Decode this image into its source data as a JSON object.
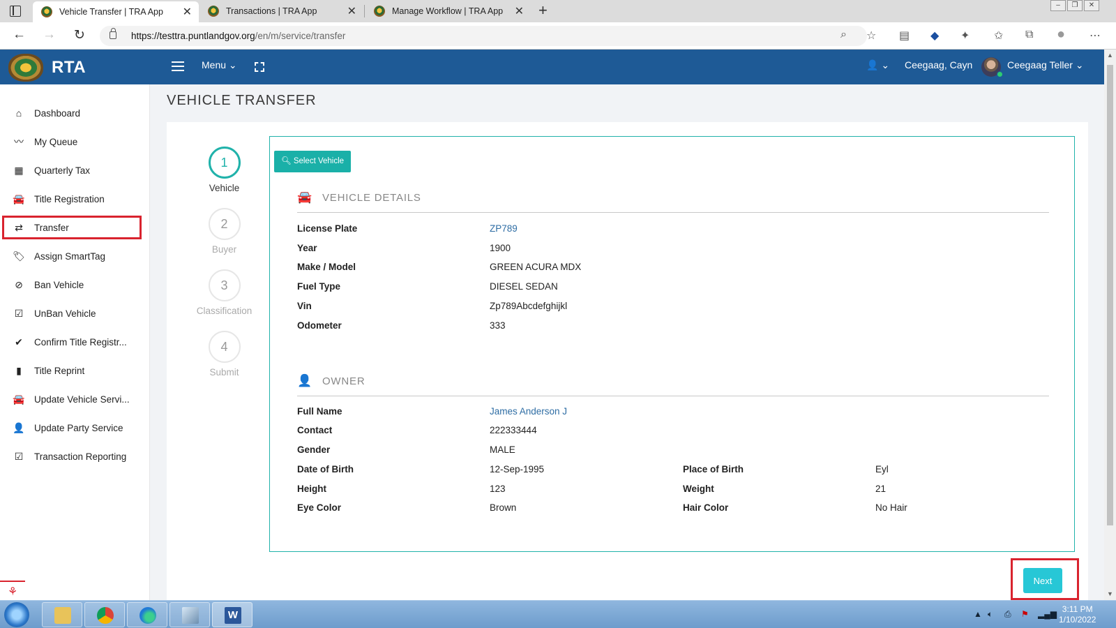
{
  "browser": {
    "tabs": [
      {
        "title": "Vehicle Transfer | TRA App",
        "active": true
      },
      {
        "title": "Transactions | TRA App",
        "active": false
      },
      {
        "title": "Manage Workflow | TRA App",
        "active": false
      }
    ],
    "url_host": "https://testtra.puntlandgov.org",
    "url_path": "/en/m/service/transfer"
  },
  "header": {
    "brand": "RTA",
    "menu_label": "Menu",
    "user_short": "Ceegaag, Cayn",
    "user_role": "Ceegaag Teller"
  },
  "sidebar": {
    "items": [
      {
        "label": "Dashboard",
        "icon": "home-icon"
      },
      {
        "label": "My Queue",
        "icon": "line-chart-icon"
      },
      {
        "label": "Quarterly Tax",
        "icon": "calculator-icon"
      },
      {
        "label": "Title Registration",
        "icon": "car-icon"
      },
      {
        "label": "Transfer",
        "icon": "exchange-icon"
      },
      {
        "label": "Assign SmartTag",
        "icon": "tags-icon"
      },
      {
        "label": "Ban Vehicle",
        "icon": "ban-icon"
      },
      {
        "label": "UnBan Vehicle",
        "icon": "check-square-icon"
      },
      {
        "label": "Confirm Title Registr...",
        "icon": "check-icon"
      },
      {
        "label": "Title Reprint",
        "icon": "file-icon"
      },
      {
        "label": "Update Vehicle Servi...",
        "icon": "car-icon"
      },
      {
        "label": "Update Party Service",
        "icon": "user-icon"
      },
      {
        "label": "Transaction Reporting",
        "icon": "check-square-icon"
      }
    ]
  },
  "page": {
    "title": "VEHICLE TRANSFER",
    "steps": [
      {
        "num": "1",
        "label": "Vehicle"
      },
      {
        "num": "2",
        "label": "Buyer"
      },
      {
        "num": "3",
        "label": "Classification"
      },
      {
        "num": "4",
        "label": "Submit"
      }
    ],
    "select_vehicle_label": "Select Vehicle",
    "vehicle_section": "VEHICLE DETAILS",
    "vehicle": [
      {
        "key": "License Plate",
        "value": "ZP789"
      },
      {
        "key": "Year",
        "value": "1900"
      },
      {
        "key": "Make / Model",
        "value": "GREEN ACURA MDX"
      },
      {
        "key": "Fuel Type",
        "value": "DIESEL SEDAN"
      },
      {
        "key": "Vin",
        "value": "Zp789Abcdefghijkl"
      },
      {
        "key": "Odometer",
        "value": "333"
      }
    ],
    "owner_section": "OWNER",
    "owner": [
      {
        "key": "Full Name",
        "value": "James Anderson J"
      },
      {
        "key": "Contact",
        "value": "222333444"
      },
      {
        "key": "Gender",
        "value": "MALE"
      },
      {
        "key": "Date of Birth",
        "value": "12-Sep-1995",
        "key2": "Place of Birth",
        "value2": "Eyl"
      },
      {
        "key": "Height",
        "value": "123",
        "key2": "Weight",
        "value2": "21"
      },
      {
        "key": "Eye Color",
        "value": "Brown",
        "key2": "Hair Color",
        "value2": "No Hair"
      }
    ],
    "next_label": "Next"
  },
  "taskbar": {
    "time": "3:11 PM",
    "date": "1/10/2022"
  },
  "colors": {
    "header_bg": "#1e5a96",
    "accent_teal": "#20b2aa",
    "next_button": "#27c7d6",
    "highlight_red": "#d9232e"
  }
}
